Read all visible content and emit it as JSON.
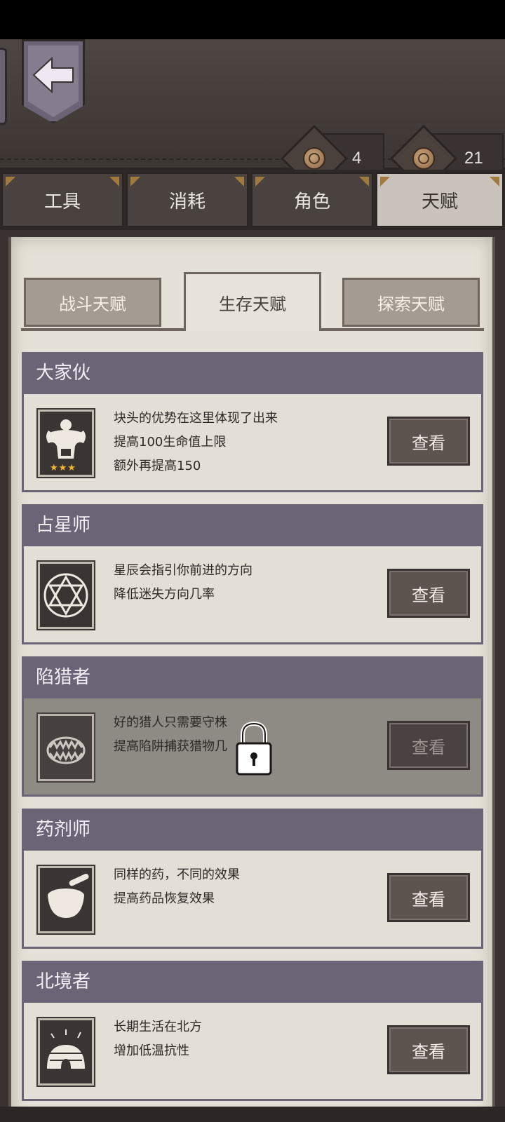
{
  "currencies": [
    {
      "icon": "coin-icon",
      "value": "4"
    },
    {
      "icon": "coin-icon",
      "value": "21"
    }
  ],
  "main_tabs": [
    {
      "label": "工具",
      "active": false
    },
    {
      "label": "消耗",
      "active": false
    },
    {
      "label": "角色",
      "active": false
    },
    {
      "label": "天赋",
      "active": true
    }
  ],
  "sub_tabs": [
    {
      "label": "战斗天赋",
      "active": false
    },
    {
      "label": "生存天赋",
      "active": true
    },
    {
      "label": "探索天赋",
      "active": false
    }
  ],
  "talents": [
    {
      "name": "大家伙",
      "icon": "muscle-man-icon",
      "stars": "★★★",
      "lines": [
        "块头的优势在这里体现了出来",
        "提高100生命值上限",
        "额外再提高150"
      ],
      "button": "查看",
      "locked": false
    },
    {
      "name": "占星师",
      "icon": "hexagram-icon",
      "lines": [
        "星辰会指引你前进的方向",
        "降低迷失方向几率"
      ],
      "button": "查看",
      "locked": false
    },
    {
      "name": "陷猎者",
      "icon": "bear-trap-icon",
      "lines": [
        "好的猎人只需要守株",
        "提高陷阱捕获猎物几"
      ],
      "button": "查看",
      "locked": true
    },
    {
      "name": "药剂师",
      "icon": "mortar-pestle-icon",
      "lines": [
        "同样的药，不同的效果",
        "提高药品恢复效果"
      ],
      "button": "查看",
      "locked": false
    },
    {
      "name": "北境者",
      "icon": "igloo-icon",
      "lines": [
        "长期生活在北方",
        "增加低温抗性"
      ],
      "button": "查看",
      "locked": false
    }
  ],
  "colors": {
    "header": "#6b6477",
    "parchment": "#e6e1d8",
    "leather": "#4a423e",
    "star": "#f2b531"
  }
}
